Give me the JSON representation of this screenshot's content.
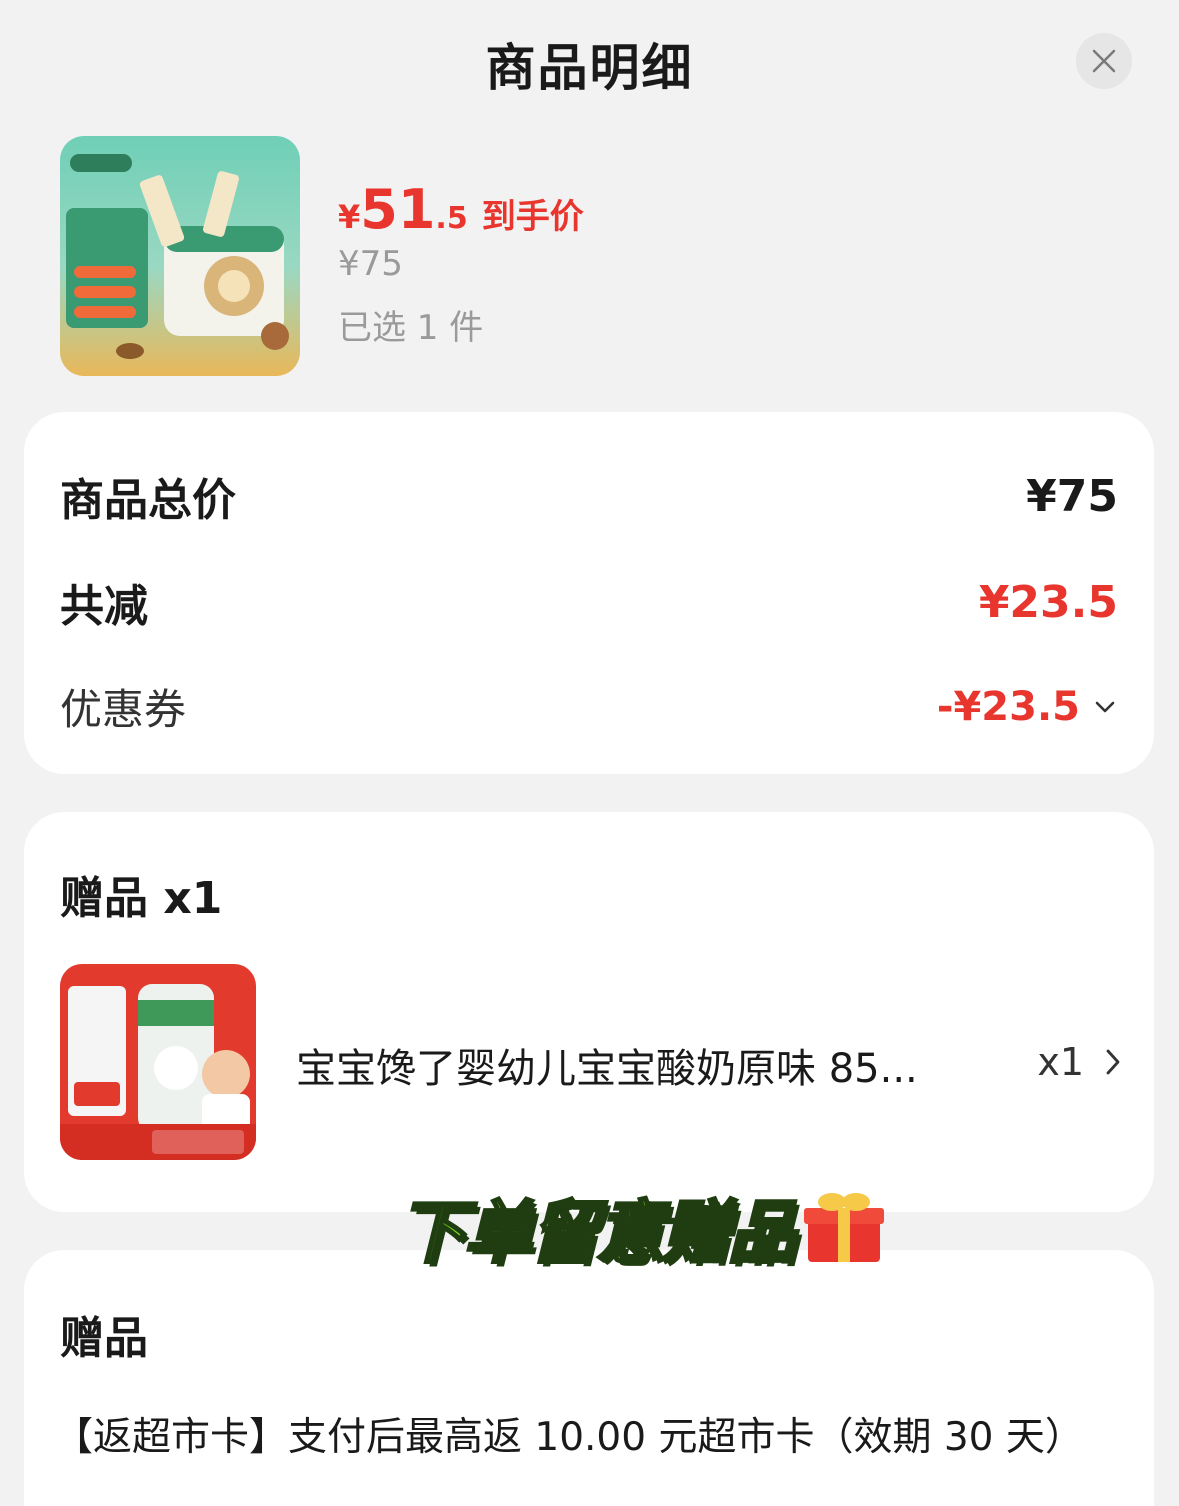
{
  "header": {
    "title": "商品明细"
  },
  "product": {
    "price_symbol": "¥",
    "price_int": "51",
    "price_dec": ".5",
    "price_label": "到手价",
    "original_price": "¥75",
    "selected_count": "已选 1 件"
  },
  "summary": {
    "total_label": "商品总价",
    "total_value": "¥75",
    "discount_label": "共减",
    "discount_value": "¥23.5",
    "coupon_label": "优惠券",
    "coupon_value": "-¥23.5"
  },
  "gift": {
    "title": "赠品 x1",
    "item_name": "宝宝馋了婴幼儿宝宝酸奶原味 85...",
    "item_qty": "x1"
  },
  "banner": {
    "text": "下单留意赠品"
  },
  "gift2": {
    "title": "赠品",
    "description": "【返超市卡】支付后最高返 10.00 元超市卡（效期 30 天）"
  },
  "colors": {
    "accent_red": "#e8352e",
    "banner_green": "#7ed321"
  },
  "icons": [
    "close-icon",
    "chevron-down-icon",
    "chevron-right-icon",
    "gift-box-icon"
  ]
}
